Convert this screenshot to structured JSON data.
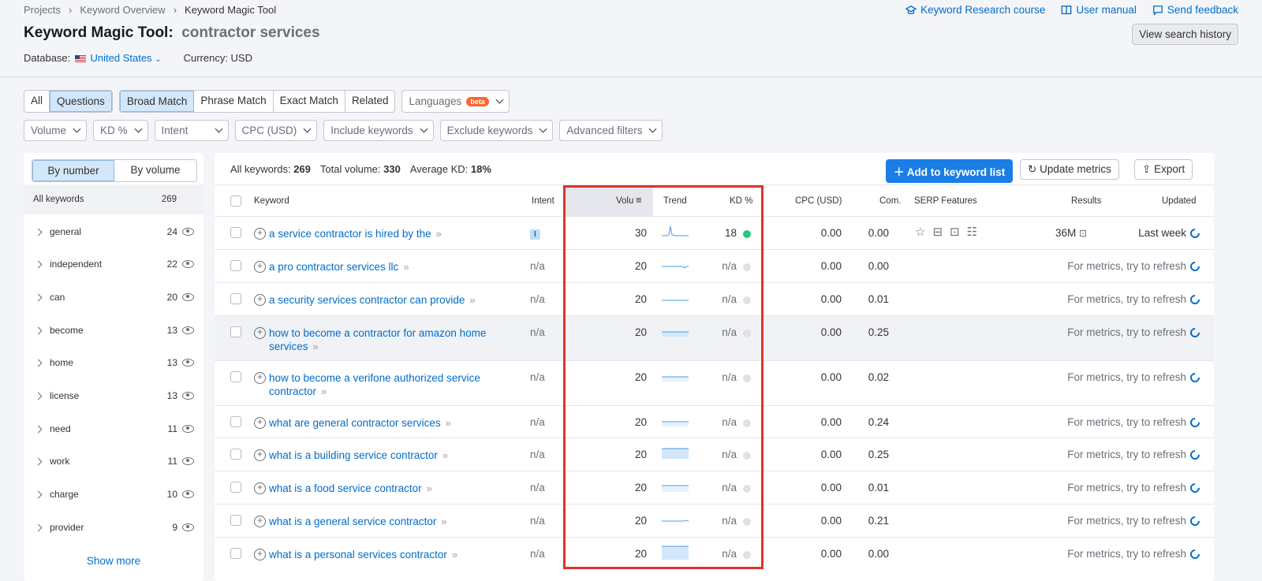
{
  "breadcrumb": [
    "Projects",
    "Keyword Overview",
    "Keyword Magic Tool"
  ],
  "top_links": {
    "course": "Keyword Research course",
    "manual": "User manual",
    "feedback": "Send feedback"
  },
  "title": {
    "label": "Keyword Magic Tool:",
    "query": "contractor services"
  },
  "view_history": "View search history",
  "database": {
    "label": "Database:",
    "country": "United States",
    "currency": "Currency: USD"
  },
  "match_tabs": {
    "all": "All",
    "questions": "Questions",
    "broad": "Broad Match",
    "phrase": "Phrase Match",
    "exact": "Exact Match",
    "related": "Related",
    "languages": "Languages",
    "beta": "beta"
  },
  "filters": {
    "volume": "Volume",
    "kd": "KD %",
    "intent": "Intent",
    "cpc": "CPC (USD)",
    "include": "Include keywords",
    "exclude": "Exclude keywords",
    "advanced": "Advanced filters"
  },
  "sidebar": {
    "by_number": "By number",
    "by_volume": "By volume",
    "all_label": "All keywords",
    "all_count": "269",
    "items": [
      {
        "label": "general",
        "count": "24"
      },
      {
        "label": "independent",
        "count": "22"
      },
      {
        "label": "can",
        "count": "20"
      },
      {
        "label": "become",
        "count": "13"
      },
      {
        "label": "home",
        "count": "13"
      },
      {
        "label": "license",
        "count": "13"
      },
      {
        "label": "need",
        "count": "11"
      },
      {
        "label": "work",
        "count": "11"
      },
      {
        "label": "charge",
        "count": "10"
      },
      {
        "label": "provider",
        "count": "9"
      }
    ],
    "show_more": "Show more"
  },
  "summary": {
    "all_label": "All keywords:",
    "all_value": "269",
    "vol_label": "Total volume:",
    "vol_value": "330",
    "kd_label": "Average KD:",
    "kd_value": "18%"
  },
  "buttons": {
    "add": "Add to keyword list",
    "update": "Update metrics",
    "export": "Export"
  },
  "columns": {
    "keyword": "Keyword",
    "intent": "Intent",
    "volume": "Volu",
    "trend": "Trend",
    "kd": "KD %",
    "cpc": "CPC (USD)",
    "com": "Com.",
    "serp": "SERP Features",
    "results": "Results",
    "updated": "Updated"
  },
  "rows": [
    {
      "keyword": "a service contractor is hired by the",
      "intent": "I",
      "volume": "30",
      "kd": "18",
      "cpc": "0.00",
      "com": "0.00",
      "results": "36M",
      "updated": "Last week"
    },
    {
      "keyword": "a pro contractor services llc",
      "intent": "n/a",
      "volume": "20",
      "kd": "n/a",
      "cpc": "0.00",
      "com": "0.00",
      "results": "",
      "updated": ""
    },
    {
      "keyword": "a security services contractor can provide",
      "intent": "n/a",
      "volume": "20",
      "kd": "n/a",
      "cpc": "0.00",
      "com": "0.01",
      "results": "",
      "updated": "For metrics, try to refresh"
    },
    {
      "keyword": "how to become a contractor for amazon home services",
      "intent": "n/a",
      "volume": "20",
      "kd": "n/a",
      "cpc": "0.00",
      "com": "0.25",
      "results": "",
      "updated": "For metrics, try to refresh"
    },
    {
      "keyword": "how to become a verifone authorized service contractor",
      "intent": "n/a",
      "volume": "20",
      "kd": "n/a",
      "cpc": "0.00",
      "com": "0.02",
      "results": "",
      "updated": "For metrics, try to refresh"
    },
    {
      "keyword": "what are general contractor services",
      "intent": "n/a",
      "volume": "20",
      "kd": "n/a",
      "cpc": "0.00",
      "com": "0.24",
      "results": "",
      "updated": "For metrics, try to refresh"
    },
    {
      "keyword": "what is a building service contractor",
      "intent": "n/a",
      "volume": "20",
      "kd": "n/a",
      "cpc": "0.00",
      "com": "0.25",
      "results": "",
      "updated": "For metrics, try to refresh"
    },
    {
      "keyword": "what is a food service contractor",
      "intent": "n/a",
      "volume": "20",
      "kd": "n/a",
      "cpc": "0.00",
      "com": "0.01",
      "results": "",
      "updated": "For metrics, try to refresh"
    },
    {
      "keyword": "what is a general service contractor",
      "intent": "n/a",
      "volume": "20",
      "kd": "n/a",
      "cpc": "0.00",
      "com": "0.21",
      "results": "",
      "updated": "For metrics, try to refresh"
    },
    {
      "keyword": "what is a personal services contractor",
      "intent": "n/a",
      "volume": "20",
      "kd": "n/a",
      "cpc": "0.00",
      "com": "0.00",
      "results": "",
      "updated": "For metrics, try to refresh"
    }
  ],
  "row1_updated_row2": "For metrics, try to refresh",
  "colors": {
    "accent": "#006dca",
    "primary_button": "#1a7ee6",
    "kd_easy": "#2bc57b",
    "highlight_box": "#e0322d"
  }
}
